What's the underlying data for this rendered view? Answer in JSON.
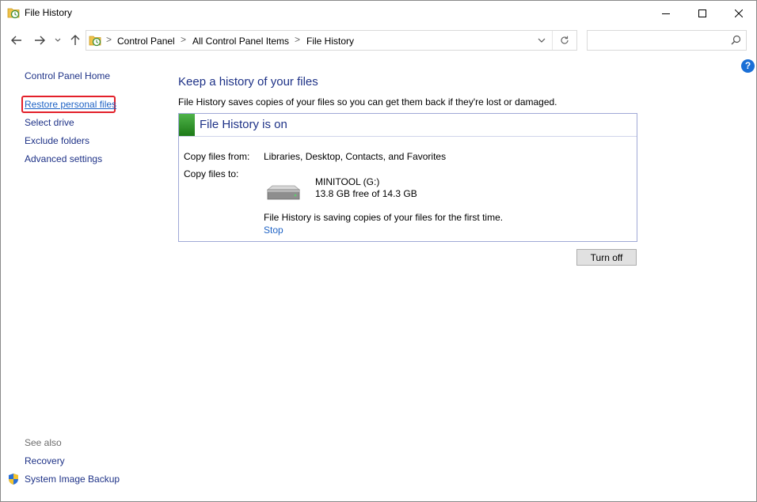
{
  "window": {
    "title": "File History"
  },
  "address": {
    "crumbs": [
      "Control Panel",
      "All Control Panel Items",
      "File History"
    ],
    "separator": ">"
  },
  "search": {
    "placeholder": ""
  },
  "sidebar": {
    "home": "Control Panel Home",
    "links": [
      "Restore personal files",
      "Select drive",
      "Exclude folders",
      "Advanced settings"
    ],
    "see_also": "See also",
    "see_also_links": [
      "Recovery",
      "System Image Backup"
    ]
  },
  "main": {
    "title": "Keep a history of your files",
    "description": "File History saves copies of your files so you can get them back if they're lost or damaged.",
    "status": "File History is on",
    "copy_from_label": "Copy files from:",
    "copy_from_value": "Libraries, Desktop, Contacts, and Favorites",
    "copy_to_label": "Copy files to:",
    "drive_name": "MINITOOL (G:)",
    "drive_free": "13.8 GB free of 14.3 GB",
    "saving_message": "File History is saving copies of your files for the first time.",
    "stop_label": "Stop",
    "turn_off_label": "Turn off"
  },
  "help": {
    "label": "?"
  },
  "colors": {
    "link": "#1e3287",
    "active_link": "#1f63c5",
    "highlight_box": "#e3202a",
    "status_green": "#2f9a29"
  }
}
